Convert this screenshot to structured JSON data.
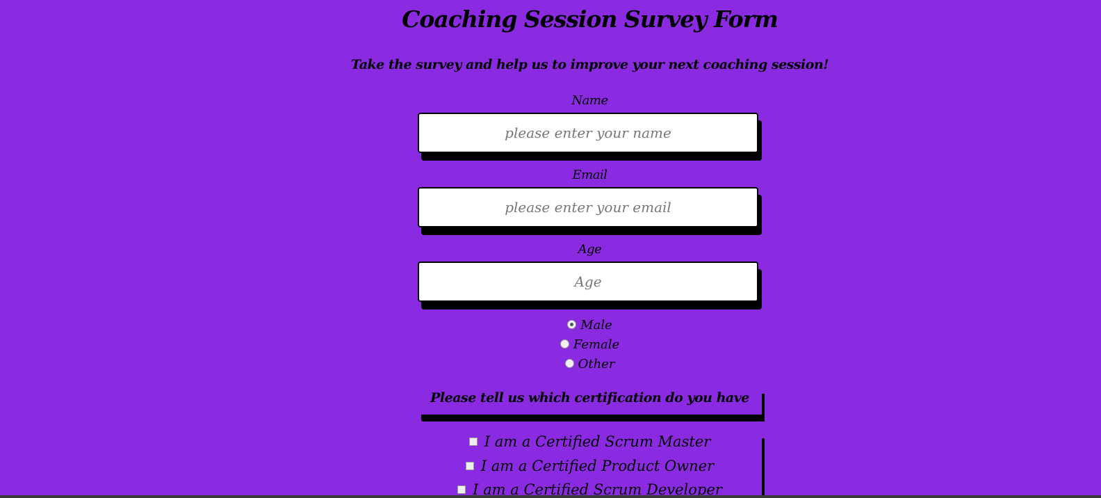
{
  "form": {
    "title": "Coaching Session Survey Form",
    "subtitle": "Take the survey and help us to improve your next coaching session!",
    "name": {
      "label": "Name",
      "placeholder": "please enter your name"
    },
    "email": {
      "label": "Email",
      "placeholder": "please enter your email"
    },
    "age": {
      "label": "Age",
      "placeholder": "Age"
    },
    "gender_options": [
      {
        "label": "Male",
        "checked": true
      },
      {
        "label": "Female",
        "checked": false
      },
      {
        "label": "Other",
        "checked": false
      }
    ],
    "certification": {
      "prompt": "Please tell us which certification do you have",
      "options": [
        {
          "label": "I am a Certified Scrum Master",
          "checked": false
        },
        {
          "label": "I am a Certified Product Owner",
          "checked": false
        },
        {
          "label": "I am a Certified Scrum Developer",
          "checked": false
        }
      ]
    }
  },
  "colors": {
    "background": "#8a2be2"
  }
}
